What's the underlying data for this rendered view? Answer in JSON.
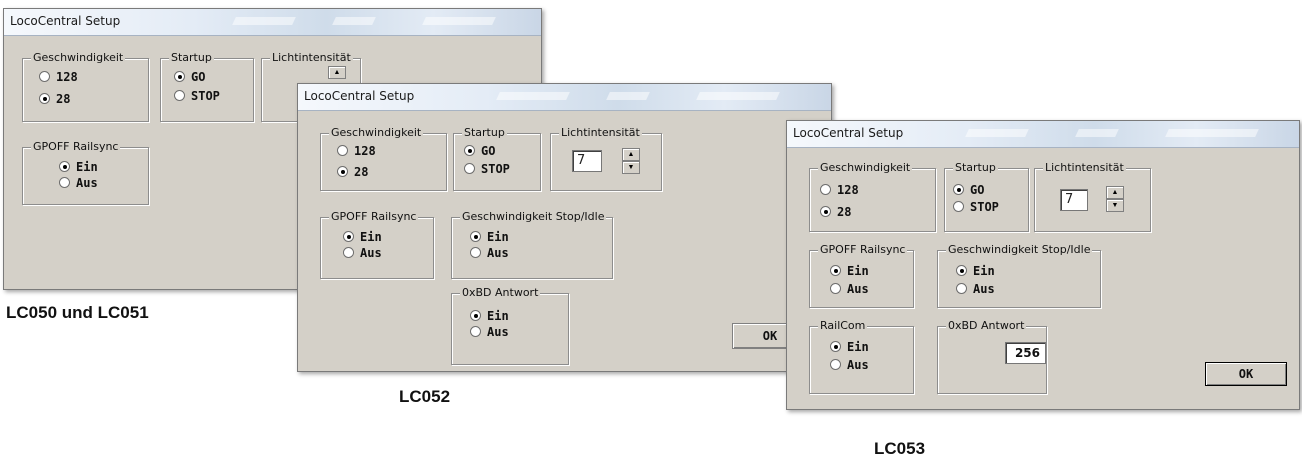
{
  "window_title": "LocoCentral Setup",
  "groups": {
    "speed": "Geschwindigkeit",
    "startup": "Startup",
    "light": "Lichtintensität",
    "gpoff": "GPOFF Railsync",
    "speed_stop": "Geschwindigkeit Stop/Idle",
    "oxbd": "0xBD Antwort",
    "railcom": "RailCom"
  },
  "options": {
    "speed_128": "128",
    "speed_28": "28",
    "go": "GO",
    "stop": "STOP",
    "ein": "Ein",
    "aus": "Aus"
  },
  "values": {
    "light_intensity": "7",
    "oxbd_value": "256"
  },
  "ok_label": "OK",
  "captions": {
    "lc050": "LC050 und LC051",
    "lc052": "LC052",
    "lc053": "LC053"
  }
}
